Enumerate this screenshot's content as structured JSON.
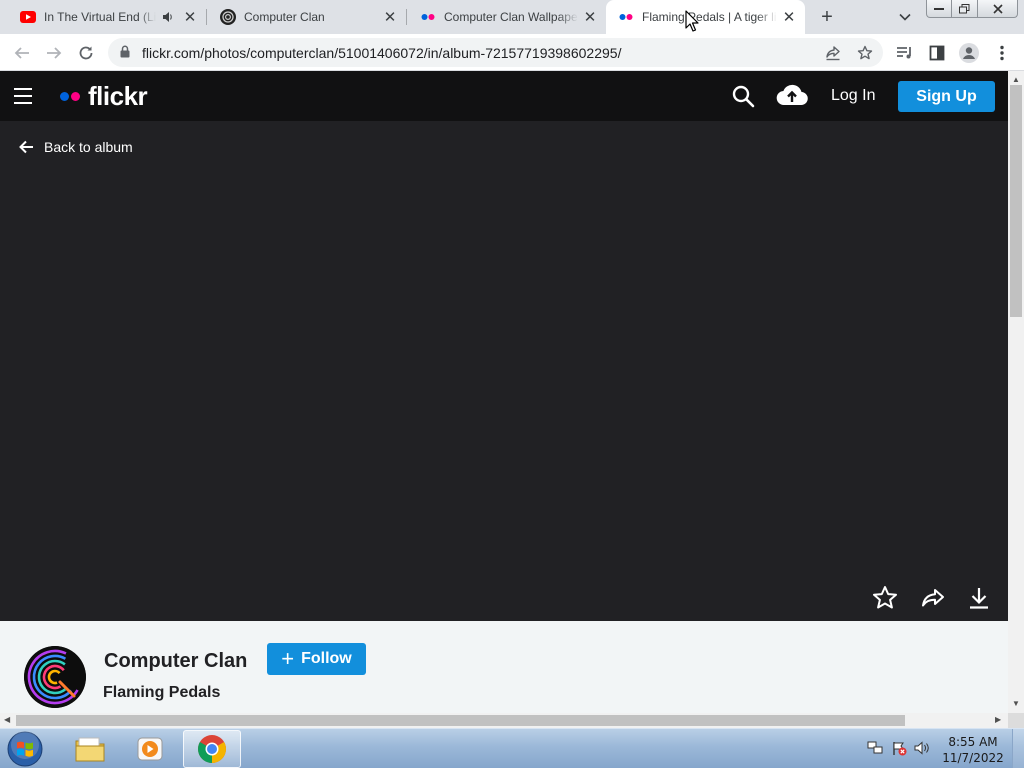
{
  "browser": {
    "tabs": [
      {
        "title": "In The Virtual End (Li",
        "favicon": "youtube-icon",
        "audio": true,
        "active": false
      },
      {
        "title": "Computer Clan",
        "favicon": "computer-clan-icon",
        "audio": false,
        "active": false
      },
      {
        "title": "Computer Clan Wallpape",
        "favicon": "flickr-icon",
        "audio": false,
        "active": false
      },
      {
        "title": "Flaming Pedals | A tiger li",
        "favicon": "flickr-icon",
        "audio": false,
        "active": true
      }
    ],
    "url": "flickr.com/photos/computerclan/51001406072/in/album-72157719398602295/"
  },
  "flickr": {
    "logo_text": "flickr",
    "login_label": "Log In",
    "signup_label": "Sign Up",
    "back_label": "Back to album",
    "owner_name": "Computer Clan",
    "follow_label": "Follow",
    "photo_title": "Flaming Pedals",
    "colors": {
      "blue": "#0063dc",
      "pink": "#ff0084",
      "accent": "#128fdc",
      "viewer_bg": "#212124"
    }
  },
  "taskbar": {
    "time": "8:55 AM",
    "date": "11/7/2022"
  }
}
